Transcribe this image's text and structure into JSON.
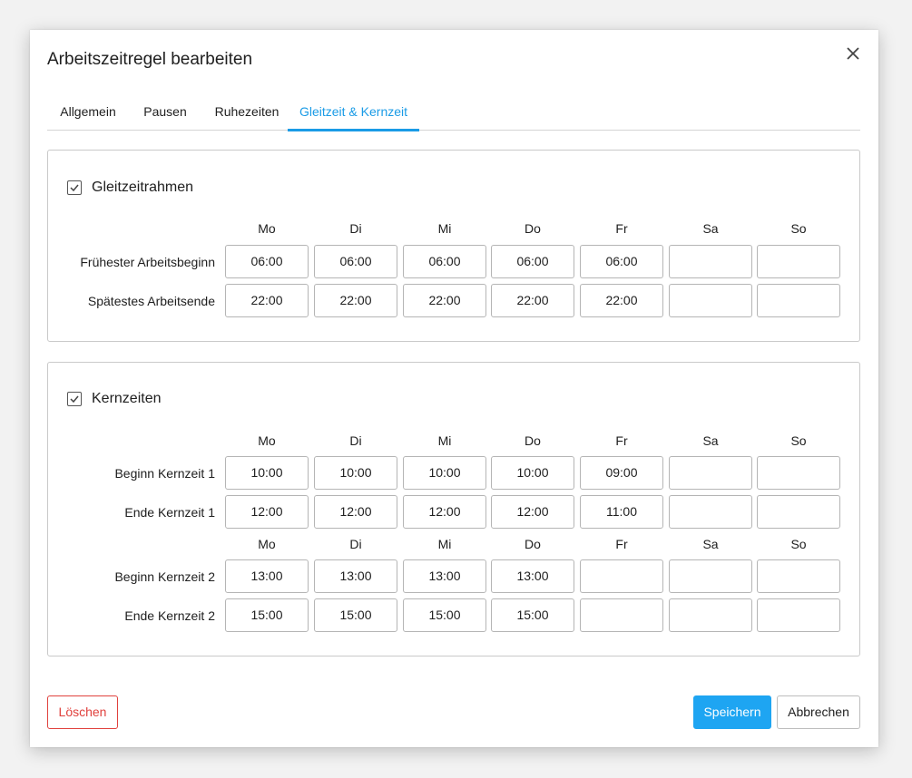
{
  "dialog": {
    "title": "Arbeitszeitregel bearbeiten"
  },
  "tabs": [
    {
      "label": "Allgemein",
      "active": false
    },
    {
      "label": "Pausen",
      "active": false
    },
    {
      "label": "Ruhezeiten",
      "active": false
    },
    {
      "label": "Gleitzeit & Kernzeit",
      "active": true
    }
  ],
  "days": [
    "Mo",
    "Di",
    "Mi",
    "Do",
    "Fr",
    "Sa",
    "So"
  ],
  "gleitzeit": {
    "title": "Gleitzeitrahmen",
    "checked": true,
    "rows": [
      {
        "label": "Frühester Arbeitsbeginn",
        "values": [
          "06:00",
          "06:00",
          "06:00",
          "06:00",
          "06:00",
          "",
          ""
        ]
      },
      {
        "label": "Spätestes Arbeitsende",
        "values": [
          "22:00",
          "22:00",
          "22:00",
          "22:00",
          "22:00",
          "",
          ""
        ]
      }
    ]
  },
  "kernzeiten": {
    "title": "Kernzeiten",
    "checked": true,
    "rows": [
      {
        "label": "Beginn Kernzeit 1",
        "values": [
          "10:00",
          "10:00",
          "10:00",
          "10:00",
          "09:00",
          "",
          ""
        ]
      },
      {
        "label": "Ende Kernzeit 1",
        "values": [
          "12:00",
          "12:00",
          "12:00",
          "12:00",
          "11:00",
          "",
          ""
        ]
      },
      {
        "label": "Beginn Kernzeit 2",
        "values": [
          "13:00",
          "13:00",
          "13:00",
          "13:00",
          "",
          "",
          ""
        ]
      },
      {
        "label": "Ende Kernzeit 2",
        "values": [
          "15:00",
          "15:00",
          "15:00",
          "15:00",
          "",
          "",
          ""
        ]
      }
    ]
  },
  "buttons": {
    "delete": "Löschen",
    "save": "Speichern",
    "cancel": "Abbrechen"
  },
  "colors": {
    "accent": "#1a9be6",
    "save_button": "#1ea5f2",
    "delete_red": "#e0413d"
  }
}
